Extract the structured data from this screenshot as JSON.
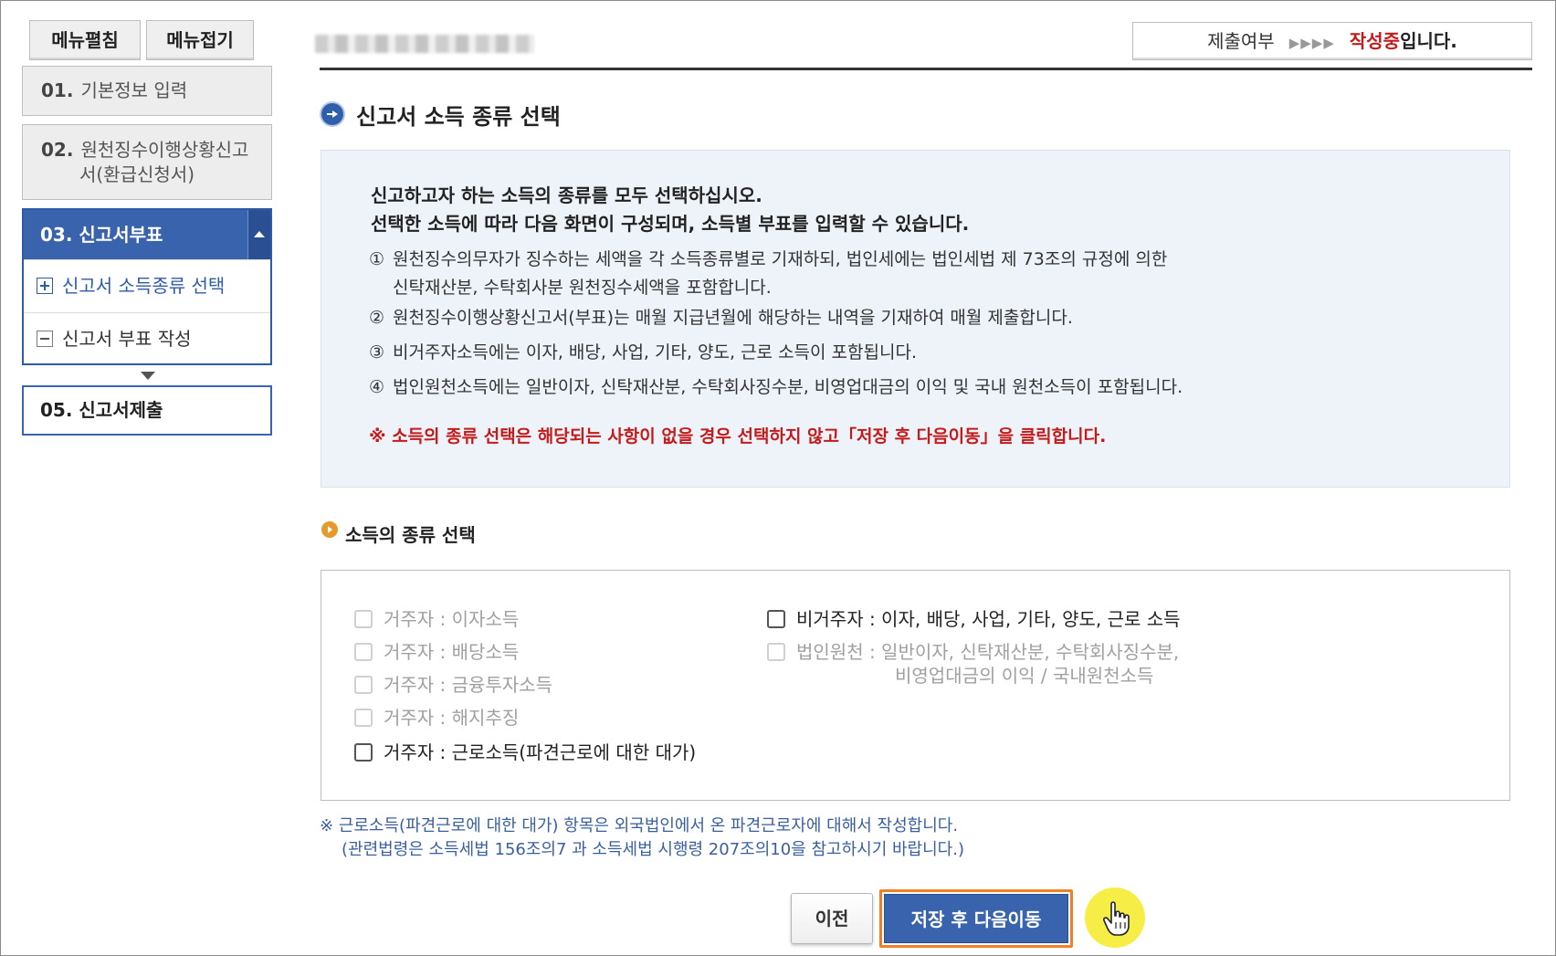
{
  "sidebar": {
    "expand_all": "메뉴펼침",
    "collapse_all": "메뉴접기",
    "items": [
      {
        "num": "01.",
        "label": "기본정보 입력"
      },
      {
        "num": "02.",
        "label": "원천징수이행상황신고",
        "label2": "서(환급신청서)"
      },
      {
        "num": "03.",
        "label": "신고서부표"
      },
      {
        "num": "05.",
        "label": "신고서제출"
      }
    ],
    "sub_items": [
      {
        "label": "신고서 소득종류 선택"
      },
      {
        "label": "신고서 부표 작성"
      }
    ]
  },
  "header": {
    "status_label": "제출여부",
    "status_arrows": "▶▶▶▶",
    "status_value": "작성중",
    "status_suffix": "입니다."
  },
  "section": {
    "title": "신고서 소득 종류 선택",
    "info_line1": "신고하고자 하는 소득의 종류를 모두 선택하십시오.",
    "info_line2": "선택한 소득에 따라 다음 화면이 구성되며, 소득별 부표를 입력할 수 있습니다.",
    "items": [
      {
        "mark": "①",
        "text": "원천징수의무자가 징수하는 세액을 각 소득종류별로 기재하되, 법인세에는 법인세법 제 73조의 규정에 의한",
        "text2": "신탁재산분, 수탁회사분 원천징수세액을 포함합니다."
      },
      {
        "mark": "②",
        "text": "원천징수이행상황신고서(부표)는 매월 지급년월에 해당하는 내역을 기재하여 매월 제출합니다."
      },
      {
        "mark": "③",
        "text": "비거주자소득에는 이자, 배당, 사업, 기타, 양도, 근로 소득이 포함됩니다."
      },
      {
        "mark": "④",
        "text": "법인원천소득에는 일반이자, 신탁재산분, 수탁회사징수분, 비영업대금의 이익 및 국내 원천소득이 포함됩니다."
      }
    ],
    "warning": "※ 소득의 종류 선택은 해당되는 사항이 없을 경우 선택하지 않고「저장 후 다음이동」을 클릭합니다."
  },
  "income": {
    "title": "소득의 종류 선택",
    "left": [
      {
        "label": "거주자 : 이자소득",
        "enabled": false
      },
      {
        "label": "거주자 : 배당소득",
        "enabled": false
      },
      {
        "label": "거주자 : 금융투자소득",
        "enabled": false
      },
      {
        "label": "거주자 : 해지추징",
        "enabled": false
      },
      {
        "label": "거주자 : 근로소득(파견근로에 대한 대가)",
        "enabled": true
      }
    ],
    "right": [
      {
        "label": "비거주자 : 이자, 배당, 사업, 기타, 양도, 근로 소득",
        "enabled": true
      },
      {
        "label": "법인원천 : 일반이자, 신탁재산분, 수탁회사징수분,",
        "label2": "비영업대금의 이익 / 국내원천소득",
        "enabled": false
      }
    ],
    "note1": "※ 근로소득(파견근로에 대한 대가) 항목은 외국법인에서 온 파견근로자에 대해서 작성합니다.",
    "note2": "(관련법령은 소득세법 156조의7 과 소득세법 시행령 207조의10을 참고하시기 바랍니다.)"
  },
  "buttons": {
    "prev": "이전",
    "next": "저장 후 다음이동"
  }
}
